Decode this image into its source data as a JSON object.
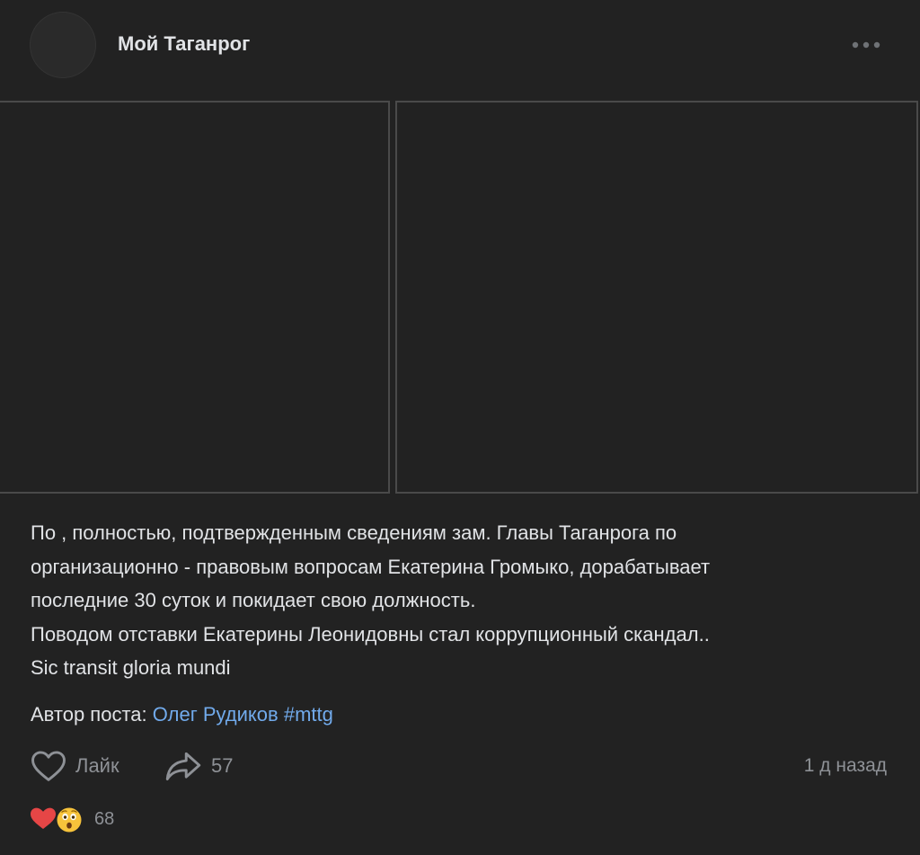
{
  "post": {
    "group_name": "Мой Таганрог",
    "text_lines": [
      "По , полностью, подтвержденным сведениям зам. Главы Таганрога по",
      "организационно - правовым вопросам Екатерина Громыко, дорабатывает",
      "последние 30 суток и покидает свою должность.",
      "Поводом отставки Екатерины Леонидовны стал коррупционный скандал..",
      "Sic transit gloria mundi"
    ],
    "author_label": "Автор поста:",
    "author_name": "Олег Рудиков",
    "hashtag": "#mttg",
    "like_label": "Лайк",
    "share_count": "57",
    "time": "1 д назад",
    "reactions_count": "68"
  },
  "icons": {
    "more": "more-horizontal-icon",
    "like": "heart-outline-icon",
    "share": "share-arrow-icon",
    "reactions": [
      "heart-icon",
      "astonished-face-icon"
    ]
  },
  "colors": {
    "background": "#222222",
    "text": "#e1e3e6",
    "secondary": "#8e9196",
    "link": "#71aaeb",
    "heart": "#e64646"
  }
}
